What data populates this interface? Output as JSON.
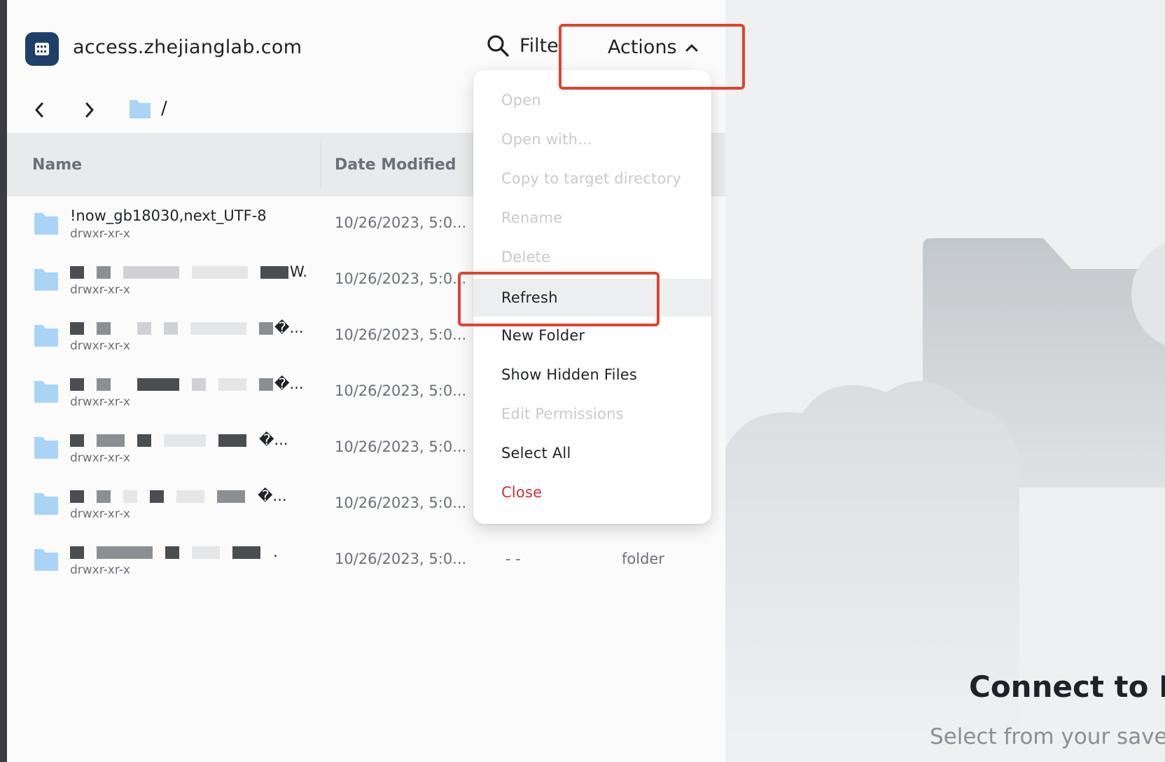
{
  "header": {
    "host": "access.zhejianglab.com",
    "filter_label": "Filte",
    "actions_label": "Actions"
  },
  "breadcrumb": {
    "path": "/"
  },
  "table": {
    "columns": [
      "Name",
      "Date Modified"
    ],
    "rows": [
      {
        "name": "!now_gb18030,next_UTF-8",
        "perm": "drwxr-xr-x",
        "date": "10/26/2023, 5:0...",
        "size": "",
        "kind": ""
      },
      {
        "name": "W...",
        "perm": "drwxr-xr-x",
        "date": "10/26/2023, 5:0...",
        "size": "",
        "kind": ""
      },
      {
        "name": "�...",
        "perm": "drwxr-xr-x",
        "date": "10/26/2023, 5:0...",
        "size": "",
        "kind": ""
      },
      {
        "name": "�...",
        "perm": "drwxr-xr-x",
        "date": "10/26/2023, 5:0...",
        "size": "",
        "kind": ""
      },
      {
        "name": "�...",
        "perm": "drwxr-xr-x",
        "date": "10/26/2023, 5:0...",
        "size": "",
        "kind": ""
      },
      {
        "name": "�...",
        "perm": "drwxr-xr-x",
        "date": "10/26/2023, 5:0...",
        "size": "",
        "kind": ""
      },
      {
        "name": ".",
        "perm": "drwxr-xr-x",
        "date": "10/26/2023, 5:0...",
        "size": "- -",
        "kind": "folder"
      }
    ]
  },
  "menu": {
    "items": [
      {
        "label": "Open",
        "disabled": true
      },
      {
        "label": "Open with...",
        "disabled": true
      },
      {
        "label": "Copy to target directory",
        "disabled": true
      },
      {
        "label": "Rename",
        "disabled": true
      },
      {
        "label": "Delete",
        "disabled": true
      },
      {
        "label": "Refresh",
        "disabled": false
      },
      {
        "label": "New Folder",
        "disabled": false
      },
      {
        "label": "Show Hidden Files",
        "disabled": false
      },
      {
        "label": "Edit Permissions",
        "disabled": true
      },
      {
        "label": "Select All",
        "disabled": false
      },
      {
        "label": "Close",
        "disabled": false
      }
    ]
  },
  "right_panel": {
    "title": "Connect to Ho",
    "subtitle": "Select from your saved"
  },
  "colors": {
    "accent_red": "#e0432f",
    "close_red": "#d12f2f",
    "folder_blue": "#a9d4f5"
  }
}
